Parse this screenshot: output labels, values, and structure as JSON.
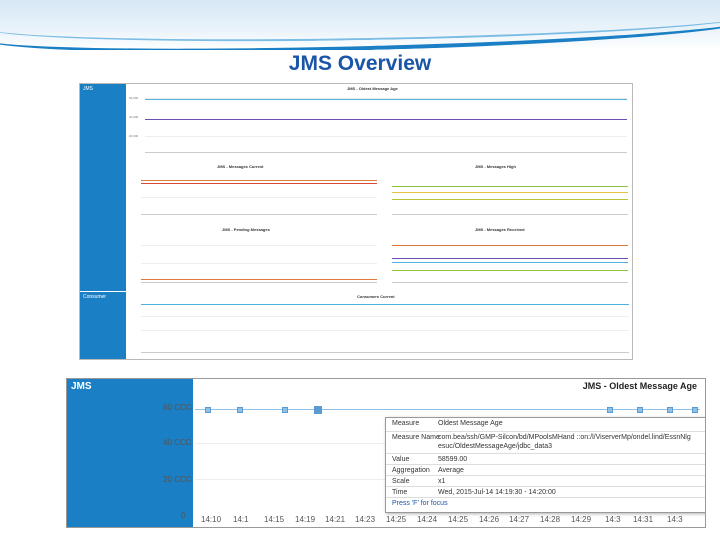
{
  "slide": {
    "title": "JMS Overview"
  },
  "dashboard": {
    "jms_label": "JMS",
    "consumer_label": "Consumer",
    "oldest_title": "JMS - Oldest Message Age",
    "oldest_y_ticks": [
      "60,000",
      "40,000",
      "20,000"
    ],
    "current_title": "JMS - Messages Current",
    "high_title": "JMS - Messages High",
    "pending_title": "JMS - Pending Messages",
    "received_title": "JMS - Messages Received",
    "consumers_title": "Consumers Current"
  },
  "zoom": {
    "jms_label": "JMS",
    "title": "JMS - Oldest Message Age",
    "y_ticks": [
      "60 CCC",
      "40 CCC",
      "20 CCC",
      "0"
    ],
    "x_ticks": [
      "14:10",
      "14:1",
      "14:15",
      "14:19",
      "14:21",
      "14:23",
      "14:25",
      "14:24",
      "14:25",
      "14:26",
      "14:27",
      "14:28",
      "14:29",
      "14:3",
      "14:31",
      "14:3"
    ],
    "tooltip": {
      "measure_label": "Measure",
      "measure_value": "Oldest Message Age",
      "name_label": "Measure Name",
      "name_line1": "com.bea/ssh/GMP-Silcon/bd/MPoolsMHand ::on:/l/ViserverMp/ondel.lind/EssnNlg",
      "name_line2": "esuc/OldestMessageAge/jdbc_data3",
      "value_label": "Value",
      "value": "58599.00",
      "agg_label": "Aggregation",
      "agg_value": "Average",
      "scale_label": "Scale",
      "scale_value": "x1",
      "time_label": "Time",
      "time_value": "Wed, 2015-Jul-14 14:19:30 - 14:20:00",
      "hint": "Press 'F' for focus"
    }
  },
  "colors": {
    "accent": "#1a7fc4",
    "title_blue": "#1a55a8",
    "line_blue": "#4fb3d9",
    "line_purple": "#6a4fb3",
    "line_orange": "#e07a3c",
    "line_green": "#8cc63f",
    "line_yellow": "#f0c040"
  }
}
